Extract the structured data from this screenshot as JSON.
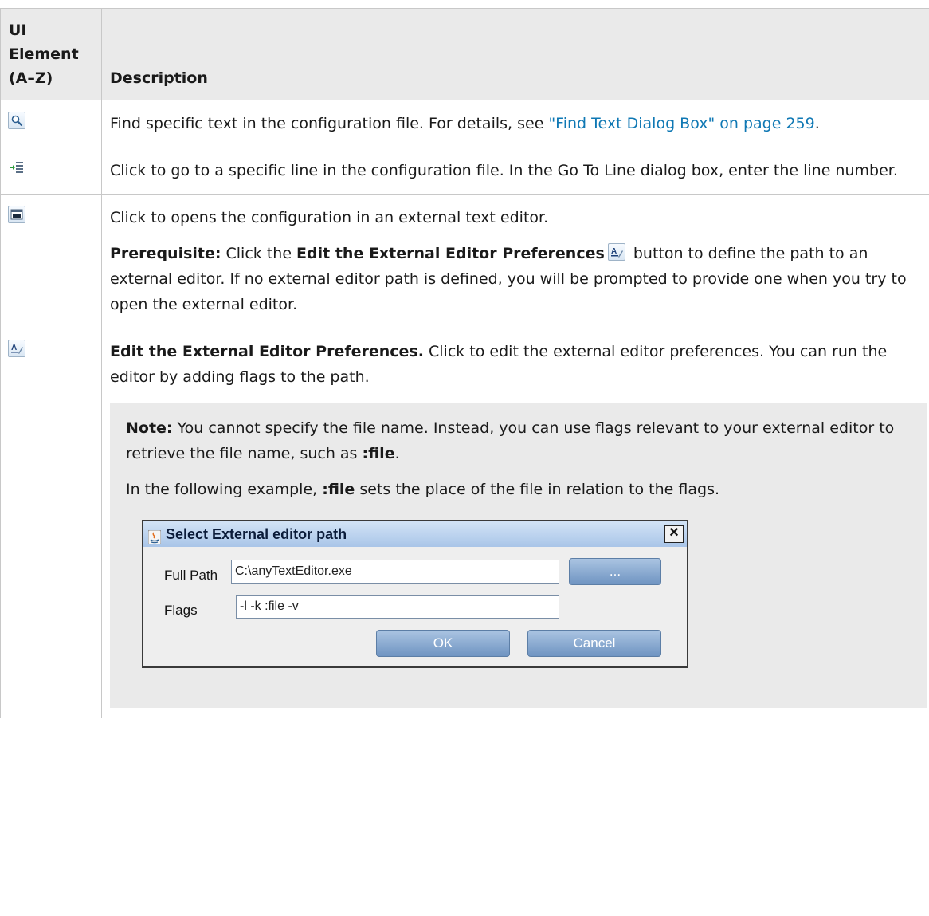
{
  "table": {
    "header": {
      "col1_lines": [
        "UI",
        "Element",
        "(A–Z)"
      ],
      "col2": "Description"
    },
    "rows": [
      {
        "icon": "find-text-icon",
        "text_before": "Find specific text in the configuration file. For details, see ",
        "link": "\"Find Text Dialog Box\" on page 259",
        "text_after": "."
      },
      {
        "icon": "go-to-line-icon",
        "text": "Click to go to a specific line in the configuration file. In the Go To Line dialog box, enter the line number."
      },
      {
        "icon": "external-editor-icon",
        "text": "Click to opens the configuration in an external text editor.",
        "prereq_label": "Prerequisite:",
        "prereq_pre": " Click the ",
        "prereq_bold": "Edit the External Editor Preferences",
        "prereq_post": " button to define the path to an external editor. If no external editor path is defined, you will be prompted to provide one when you try to open the external editor."
      },
      {
        "icon": "editor-preferences-icon",
        "title": "Edit the External Editor Preferences.",
        "text": " Click to edit the external editor preferences. You can run the editor by adding flags to the path.",
        "note": {
          "label": "Note:",
          "text1": " You cannot specify the file name. Instead, you can use flags relevant to your external editor to retrieve the file name, such as ",
          "code1": ":file",
          "text1_end": ".",
          "text2_pre": "In the following example, ",
          "code2": ":file",
          "text2_post": " sets the place of the file in relation to the flags."
        },
        "dialog": {
          "title": "Select External editor path",
          "close": "✕",
          "full_path_label": "Full Path",
          "full_path_value": "C:\\anyTextEditor.exe",
          "browse_label": "...",
          "flags_label": "Flags",
          "flags_value": "-l -k :file -v",
          "ok_label": "OK",
          "cancel_label": "Cancel"
        }
      }
    ]
  }
}
